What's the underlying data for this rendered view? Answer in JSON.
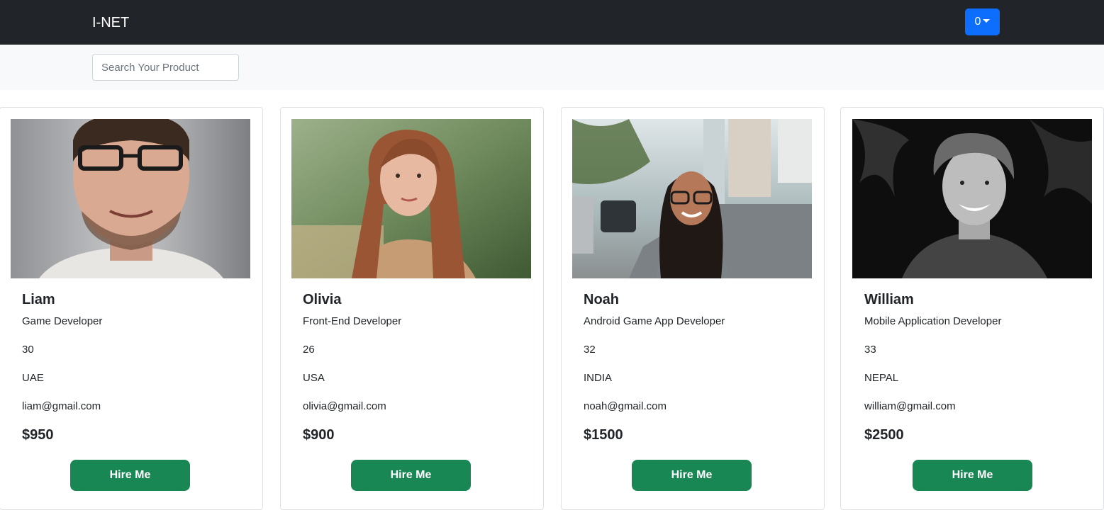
{
  "navbar": {
    "brand": "I-NET",
    "cart_count": "0",
    "accent_color": "#0d6efd"
  },
  "search": {
    "placeholder": "Search Your Product",
    "value": ""
  },
  "button_color": "#198754",
  "cards": [
    {
      "name": "Liam",
      "role": "Game Developer",
      "age": "30",
      "country": "UAE",
      "email": "liam@gmail.com",
      "price": "$950",
      "button_label": "Hire Me"
    },
    {
      "name": "Olivia",
      "role": "Front-End Developer",
      "age": "26",
      "country": "USA",
      "email": "olivia@gmail.com",
      "price": "$900",
      "button_label": "Hire Me"
    },
    {
      "name": "Noah",
      "role": "Android Game App Developer",
      "age": "32",
      "country": "INDIA",
      "email": "noah@gmail.com",
      "price": "$1500",
      "button_label": "Hire Me"
    },
    {
      "name": "William",
      "role": "Mobile Application Developer",
      "age": "33",
      "country": "NEPAL",
      "email": "william@gmail.com",
      "price": "$2500",
      "button_label": "Hire Me"
    }
  ]
}
